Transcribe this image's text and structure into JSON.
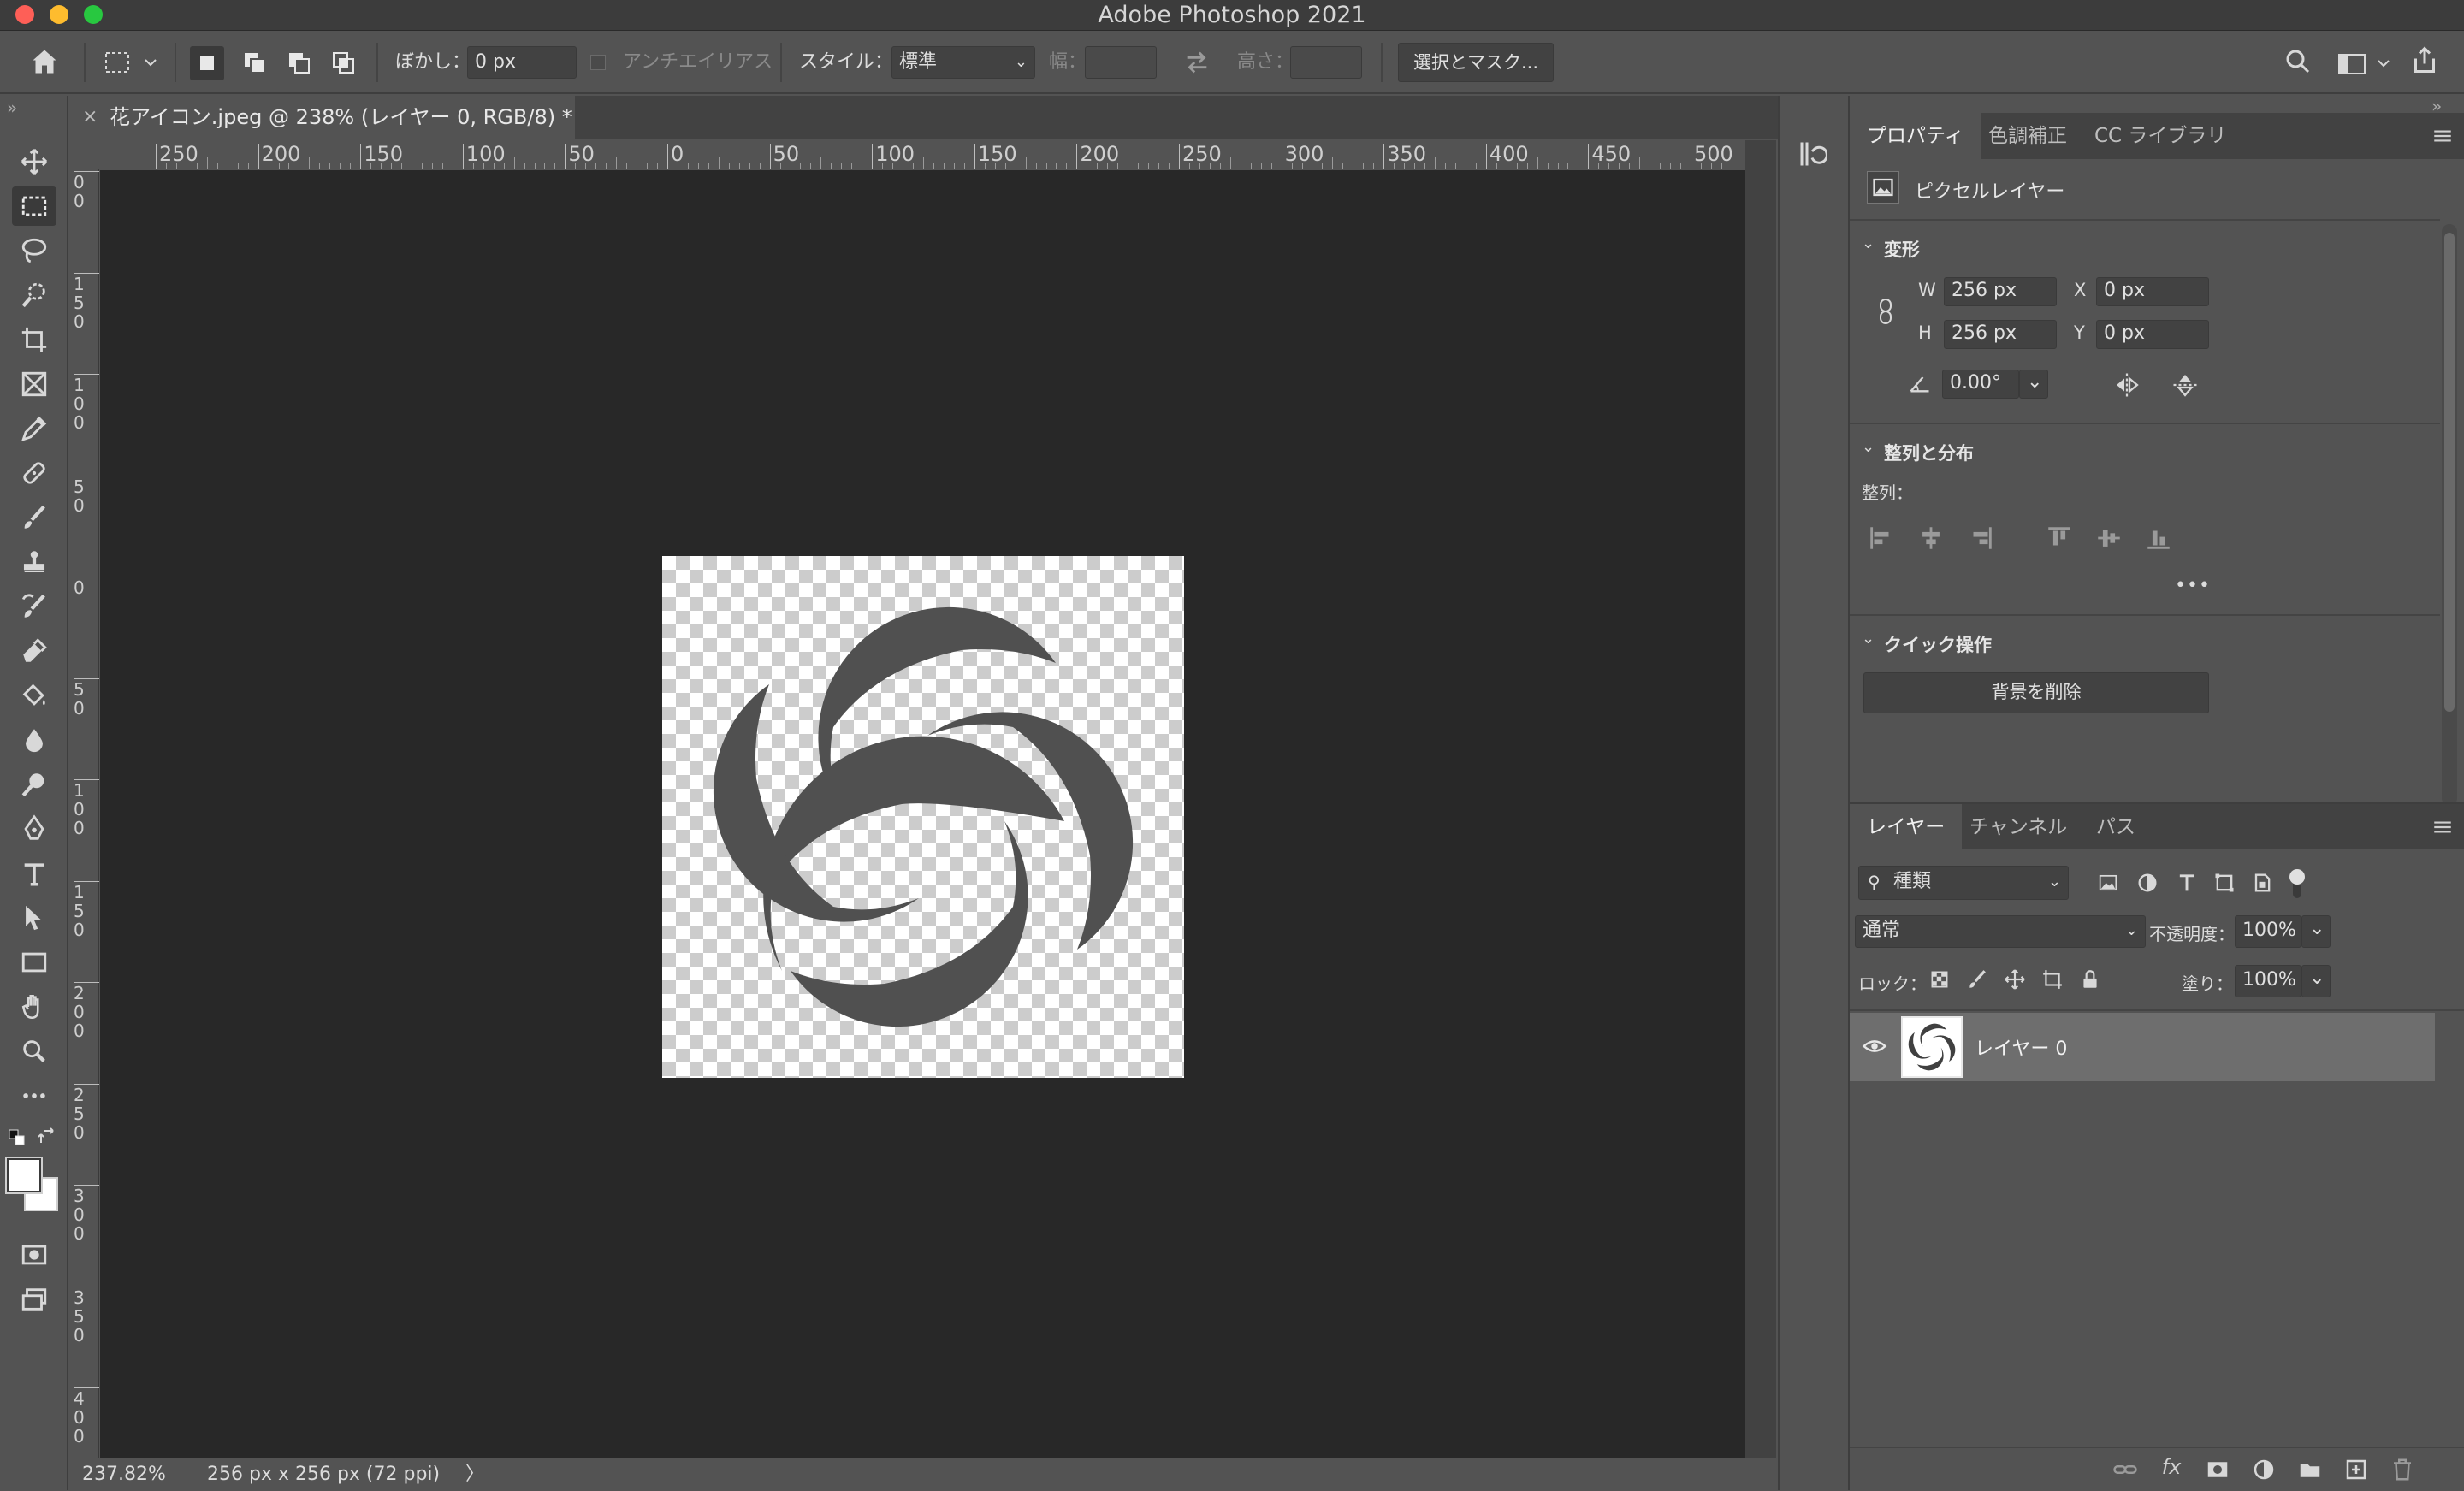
{
  "window": {
    "title": "Adobe Photoshop 2021"
  },
  "options_bar": {
    "feather_label": "ぼかし：",
    "feather_value": "0 px",
    "antialias_label": "アンチエイリアス",
    "style_label": "スタイル：",
    "style_value": "標準",
    "width_label": "幅：",
    "height_label": "高さ：",
    "select_mask_label": "選択とマスク..."
  },
  "document": {
    "tab_title": "花アイコン.jpeg @ 238% (レイヤー 0, RGB/8) *",
    "close_glyph": "×"
  },
  "ruler": {
    "h_ticks": [
      "250",
      "200",
      "150",
      "100",
      "50",
      "0",
      "50",
      "100",
      "150",
      "200",
      "250",
      "300",
      "350",
      "400",
      "450",
      "500"
    ],
    "v_ticks": [
      "0\n0",
      "1\n5\n0",
      "1\n0\n0",
      "5\n0",
      "0",
      "5\n0",
      "1\n0\n0",
      "1\n5\n0",
      "2\n0\n0",
      "2\n5\n0",
      "3\n0\n0",
      "3\n5\n0",
      "4\n0\n0"
    ]
  },
  "status_bar": {
    "zoom": "237.82%",
    "doc_info": "256 px x 256 px (72 ppi)",
    "arrow": "〉"
  },
  "properties_panel": {
    "tabs": [
      "プロパティ",
      "色調補正",
      "CC ライブラリ"
    ],
    "active_tab": "プロパティ",
    "layer_type": "ピクセルレイヤー",
    "transform": {
      "heading": "変形",
      "w_label": "W",
      "w_value": "256 px",
      "x_label": "X",
      "x_value": "0 px",
      "h_label": "H",
      "h_value": "256 px",
      "y_label": "Y",
      "y_value": "0 px",
      "angle_value": "0.00°"
    },
    "align": {
      "heading": "整列と分布",
      "label": "整列：",
      "more": "•••"
    },
    "quick_actions": {
      "heading": "クイック操作",
      "remove_bg": "背景を削除"
    }
  },
  "layers_panel": {
    "tabs": [
      "レイヤー",
      "チャンネル",
      "パス"
    ],
    "active_tab": "レイヤー",
    "filter_value": "種類",
    "blend_mode": "通常",
    "opacity_label": "不透明度：",
    "opacity_value": "100%",
    "lock_label": "ロック：",
    "fill_label": "塗り：",
    "fill_value": "100%",
    "layers": [
      {
        "name": "レイヤー 0",
        "visible": true
      }
    ]
  },
  "colors": {
    "traffic_close": "#fe5f57",
    "traffic_min": "#febc2e",
    "traffic_max": "#28c840",
    "flower_fill": "#505050",
    "canvas_bg": "#282828"
  }
}
